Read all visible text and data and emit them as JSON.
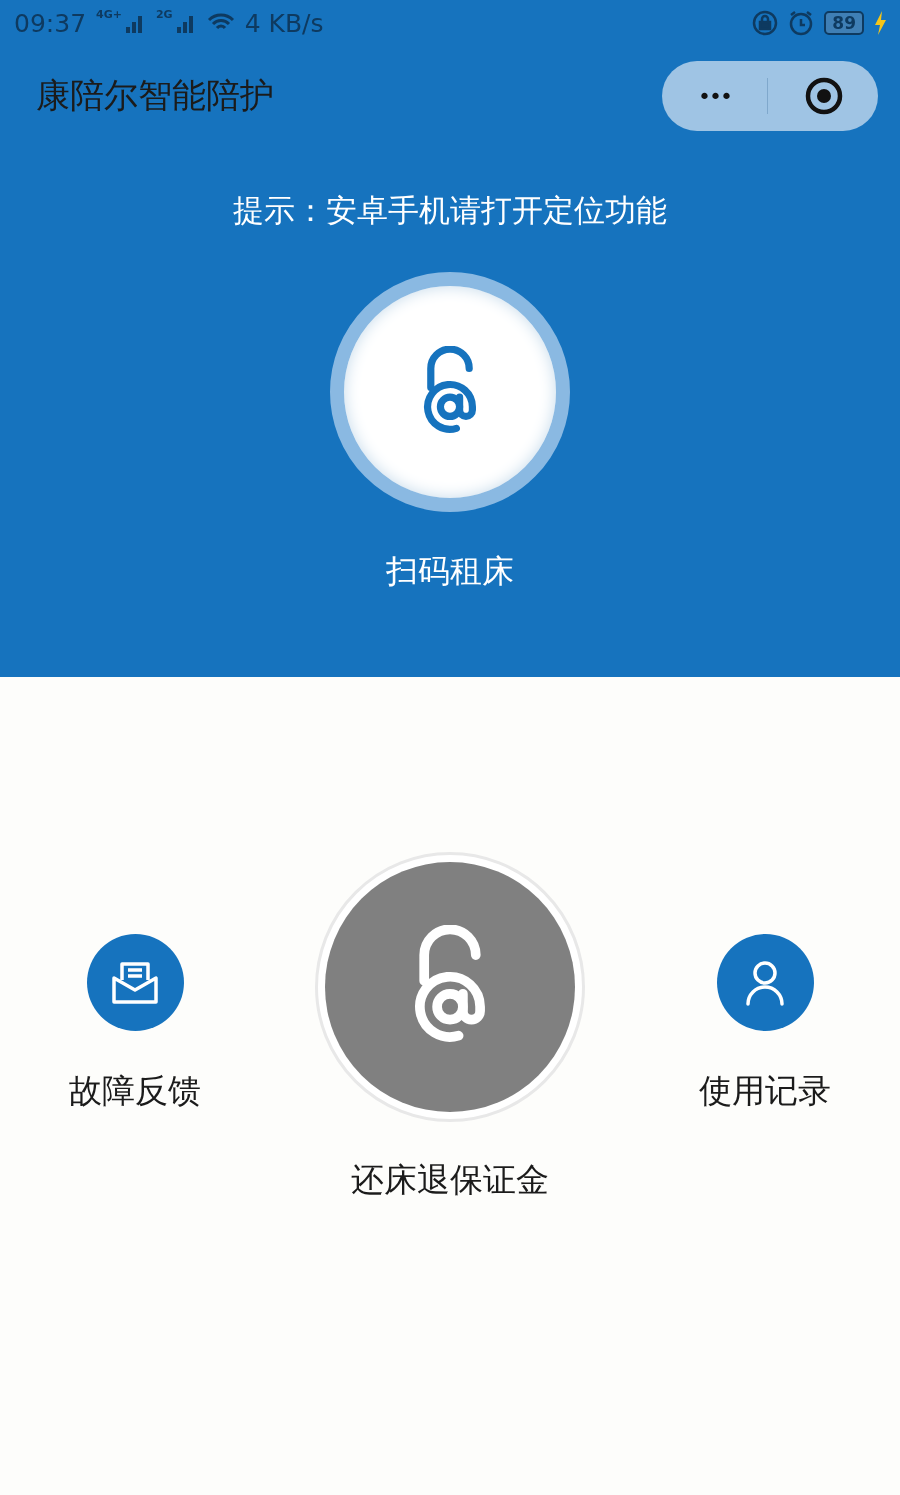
{
  "status_bar": {
    "time": "09:37",
    "network_1": "4G+",
    "network_2": "2G",
    "speed": "4 KB/s",
    "battery": "89",
    "charging": true
  },
  "title_bar": {
    "title": "康陪尔智能陪护",
    "menu_dots": "•••"
  },
  "hint": "提示：安卓手机请打开定位功能",
  "scan_button": {
    "label": "扫码租床"
  },
  "actions": [
    {
      "kind": "feedback",
      "label": "故障反馈"
    },
    {
      "kind": "return",
      "label": "还床退保证金",
      "disabled": true
    },
    {
      "kind": "records",
      "label": "使用记录"
    }
  ]
}
